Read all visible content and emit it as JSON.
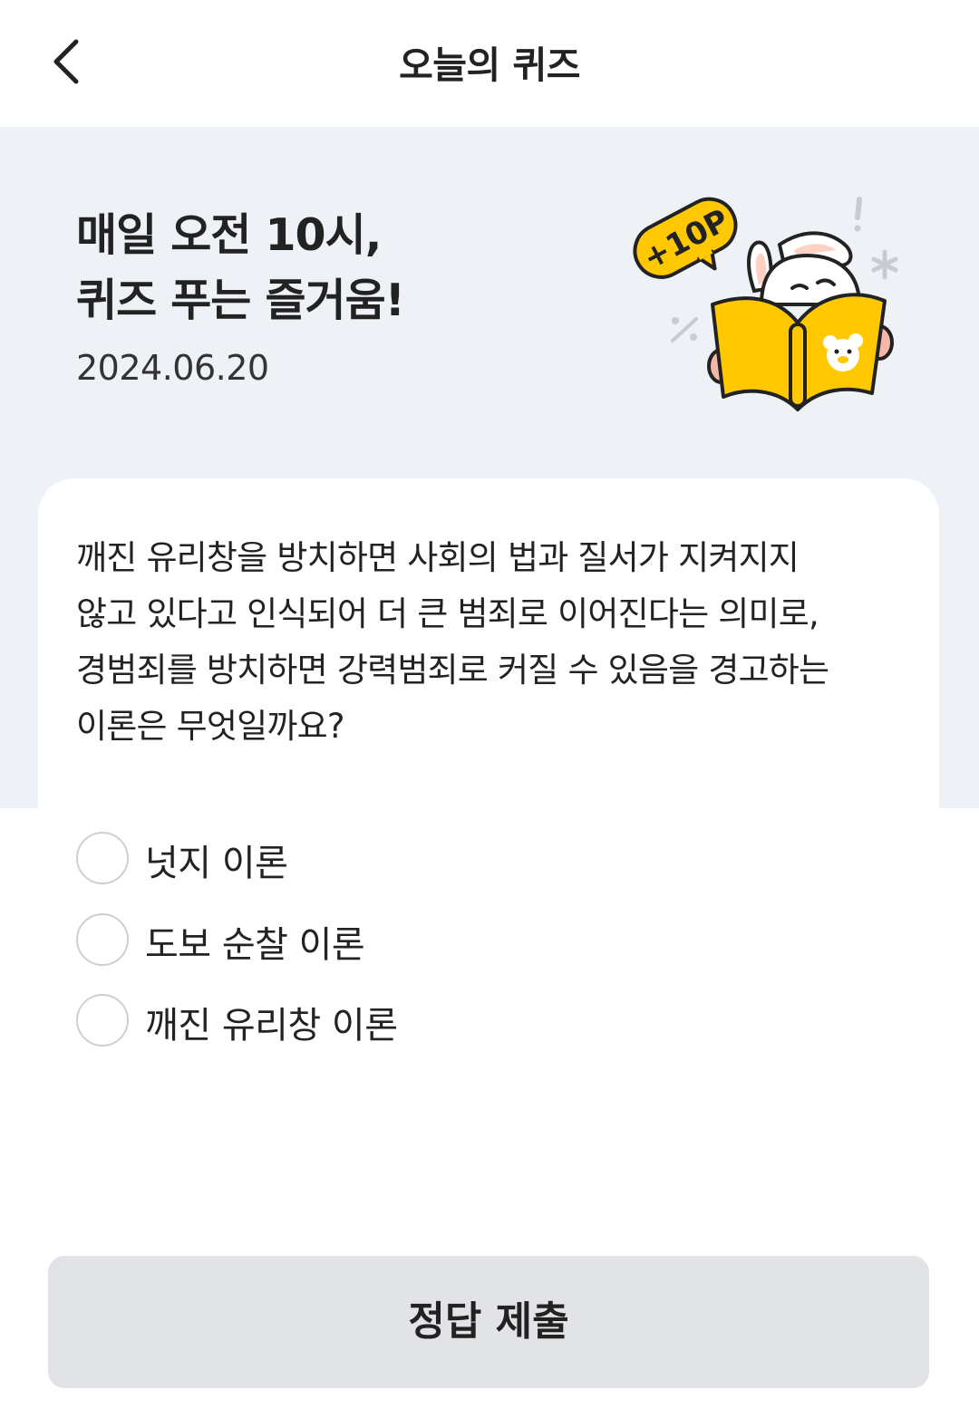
{
  "header": {
    "title": "오늘의 퀴즈",
    "back_icon": "chevron-left-icon"
  },
  "hero": {
    "headline_line1": "매일 오전 10시,",
    "headline_line2": "퀴즈 푸는 즐거움!",
    "date": "2024.06.20",
    "badge": "+10P",
    "accent_color": "#ffc800"
  },
  "quiz": {
    "question_lines": [
      "깨진 유리창을 방치하면 사회의 법과 질서가 지켜지지",
      "않고 있다고 인식되어 더 큰 범죄로 이어진다는 의미로,",
      "경범죄를 방치하면 강력범죄로 커질 수 있음을 경고하는",
      "이론은 무엇일까요?"
    ],
    "options": [
      "넛지 이론",
      "도보 순찰 이론",
      "깨진 유리창 이론"
    ]
  },
  "submit": {
    "label": "정답 제출"
  }
}
